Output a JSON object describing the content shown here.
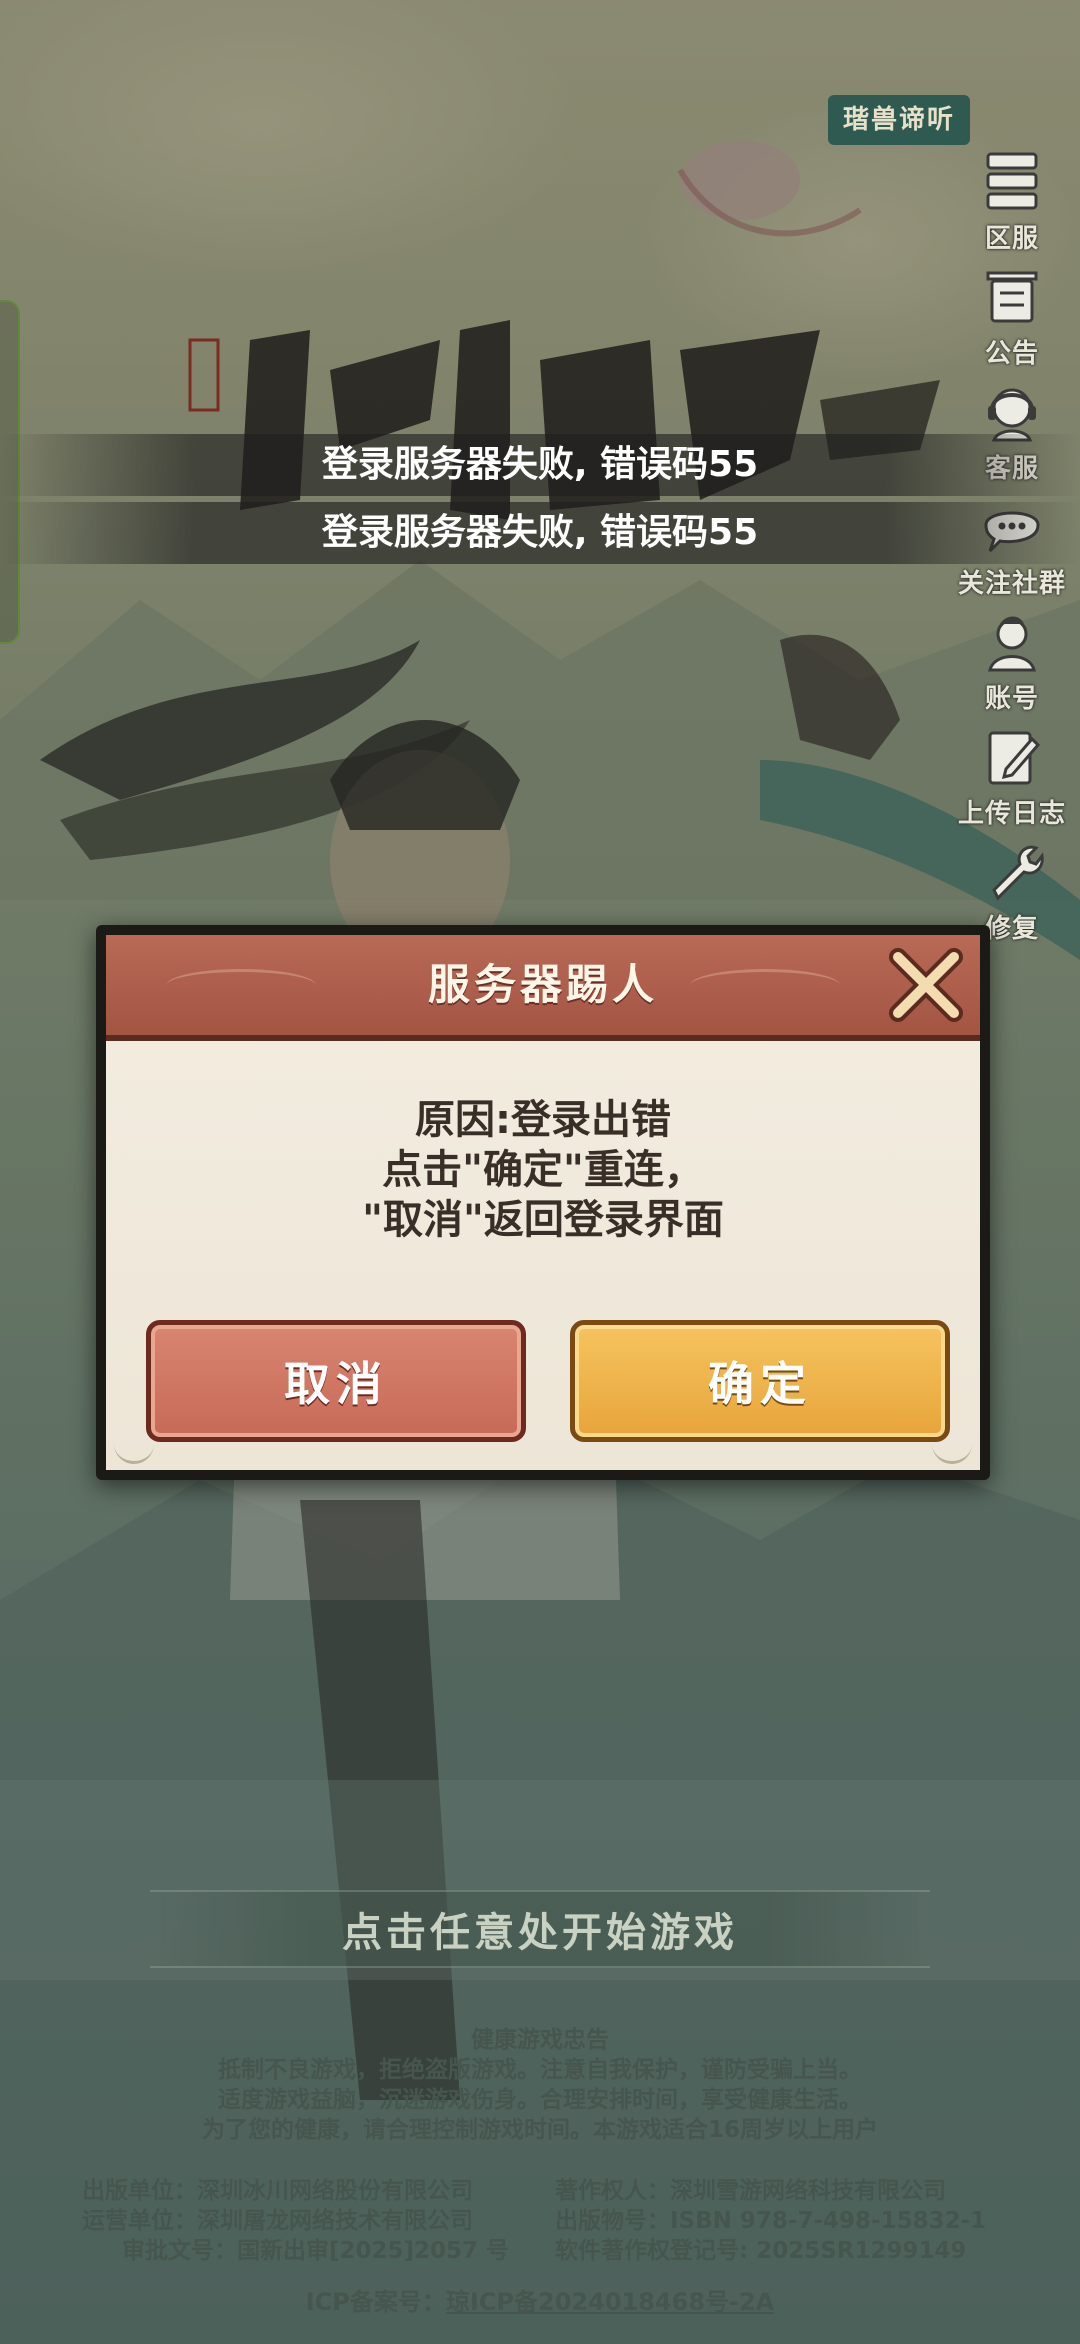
{
  "toasts": [
    "登录服务器失败, 错误码55",
    "登录服务器失败, 错误码55"
  ],
  "side_bubble": "瑎兽谛听",
  "side_menu": [
    {
      "label": "区服",
      "icon": "server-list-icon"
    },
    {
      "label": "公告",
      "icon": "notice-board-icon"
    },
    {
      "label": "客服",
      "icon": "customer-service-icon"
    },
    {
      "label": "关注社群",
      "icon": "chat-bubble-icon"
    },
    {
      "label": "账号",
      "icon": "account-avatar-icon"
    },
    {
      "label": "上传日志",
      "icon": "upload-log-icon"
    },
    {
      "label": "修复",
      "icon": "repair-wrench-icon"
    }
  ],
  "dialog": {
    "title": "服务器踢人",
    "message_lines": [
      "原因:登录出错",
      "点击\"确定\"重连，",
      "\"取消\"返回登录界面"
    ],
    "cancel_label": "取消",
    "ok_label": "确定"
  },
  "start_prompt": "点击任意处开始游戏",
  "health_notice": {
    "title": "健康游戏忠告",
    "lines": [
      "抵制不良游戏，拒绝盗版游戏。注意自我保护，谨防受骗上当。",
      "适度游戏益脑，沉迷游戏伤身。合理安排时间，享受健康生活。",
      "为了您的健康，请合理控制游戏时间。本游戏适合16周岁以上用户"
    ]
  },
  "publishing": {
    "publisher": "出版单位：深圳冰川网络股份有限公司",
    "copyright_owner": "著作权人：深圳雪游网络科技有限公司",
    "operator": "运营单位：深圳屠龙网络技术有限公司",
    "isbn": "出版物号：ISBN 978-7-498-15832-1",
    "approval": "审批文号：国新出审[2025]2057 号",
    "software_reg": "软件著作权登记号: 2025SR1299149"
  },
  "icp": {
    "prefix": "ICP备案号：",
    "link": "琼ICP备2024018468号-2A"
  },
  "colors": {
    "dialog_header": "#a35443",
    "cancel_button": "#c76a57",
    "ok_button": "#e7a53b",
    "side_bubble": "#2f5a52"
  }
}
